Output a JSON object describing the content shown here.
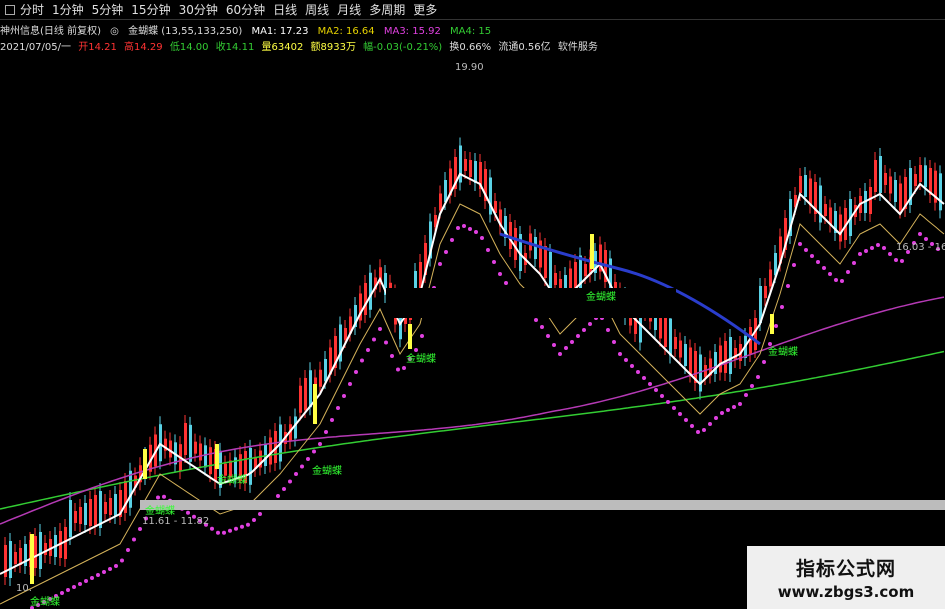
{
  "toolbar": {
    "periods": [
      "分时",
      "1分钟",
      "5分钟",
      "15分钟",
      "30分钟",
      "60分钟",
      "日线",
      "周线",
      "月线",
      "多周期",
      "更多"
    ]
  },
  "legend": {
    "stock": "神州信息(日线 前复权)",
    "indicator": "金蝴蝶",
    "params": "(13,55,133,250)",
    "ma1": "MA1: 17.23",
    "ma2": "MA2: 16.64",
    "ma3": "MA3: 15.92",
    "ma4": "MA4: 15"
  },
  "quote": {
    "date": "2021/07/05/一",
    "open": "开14.21",
    "high": "高14.29",
    "low": "低14.00",
    "close": "收14.11",
    "volume": "量63402",
    "amount": "额8933万",
    "change": "幅-0.03(-0.21%)",
    "turnover": "换0.66%",
    "market_cap": "流通0.56亿",
    "service": "软件服务"
  },
  "annotations": {
    "peak_high": "19.90",
    "low_range": "11.61 - 11.82",
    "right_range": "16.03 - 16",
    "bottom_left": "10.",
    "signal_label": "金蝴蝶"
  },
  "watermark": {
    "title": "指标公式网",
    "url": "www.zbgs3.com"
  },
  "colors": {
    "up": "#ff3333",
    "down": "#5ad2e6",
    "white_line": "#ffffff",
    "yellow_line": "#d4b25a",
    "magenta_line": "#b53ab5",
    "green_line": "#33cc33",
    "blue_line": "#2a3dcc",
    "signal_dots": "#e040e0",
    "signal_bar": "#ffff44"
  },
  "chart_data": {
    "type": "candlestick",
    "price_annotations": [
      "19.90",
      "11.61 - 11.82",
      "16.03 - 16",
      "10."
    ],
    "series": [
      {
        "name": "MA1",
        "last": 17.23
      },
      {
        "name": "MA2",
        "last": 16.64
      },
      {
        "name": "MA3",
        "last": 15.92
      },
      {
        "name": "MA4",
        "last": 15
      }
    ]
  }
}
